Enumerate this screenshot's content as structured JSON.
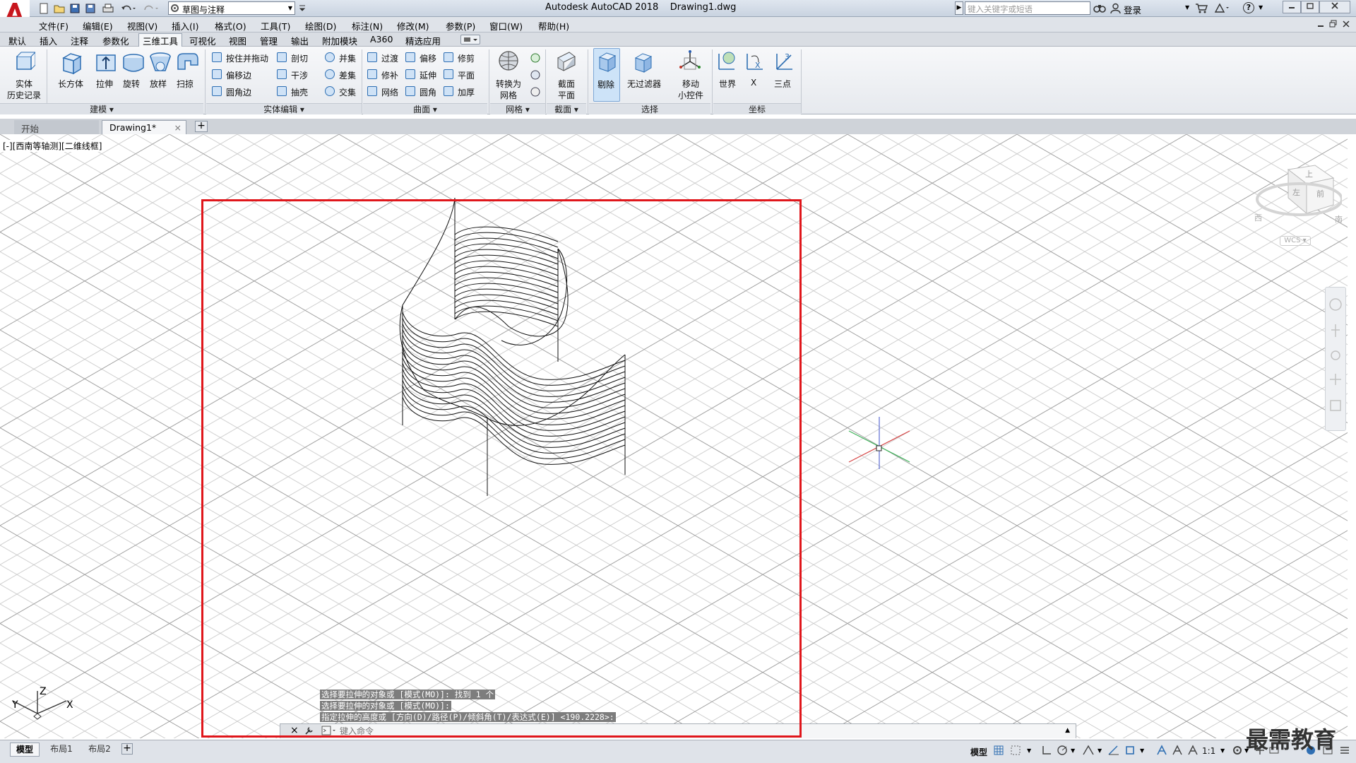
{
  "title": {
    "app_name": "Autodesk AutoCAD 2018",
    "file_name": "Drawing1.dwg"
  },
  "quick_access": {
    "workspace": "草图与注释"
  },
  "search": {
    "placeholder": "键入关键字或短语",
    "login_label": "登录"
  },
  "menu": [
    "文件(F)",
    "编辑(E)",
    "视图(V)",
    "插入(I)",
    "格式(O)",
    "工具(T)",
    "绘图(D)",
    "标注(N)",
    "修改(M)",
    "参数(P)",
    "窗口(W)",
    "帮助(H)"
  ],
  "ribbon_tabs": [
    "默认",
    "插入",
    "注释",
    "参数化",
    "三维工具",
    "可视化",
    "视图",
    "管理",
    "输出",
    "附加模块",
    "A360",
    "精选应用"
  ],
  "active_ribbon_tab": "三维工具",
  "ribbon": {
    "history_line1": "实体",
    "history_line2": "历史记录",
    "modeling_tools": [
      "长方体",
      "拉伸",
      "旋转",
      "放样",
      "扫掠"
    ],
    "solid_edit_col1": [
      "按住并拖动",
      "偏移边",
      "圆角边"
    ],
    "solid_edit_col2": [
      "剖切",
      "干涉",
      "抽壳"
    ],
    "solid_edit_col3": [
      "并集",
      "差集",
      "交集"
    ],
    "surface_col1": [
      "过渡",
      "修补",
      "网络"
    ],
    "surface_col2": [
      "偏移",
      "延伸",
      "圆角"
    ],
    "surface_col3": [
      "修剪",
      "平面",
      "加厚"
    ],
    "mesh_line1": "转换为",
    "mesh_line2": "网格",
    "section_line1": "截面",
    "section_line2": "平面",
    "select_tools": [
      "剔除",
      "无过滤器"
    ],
    "gizmo_line1": "移动",
    "gizmo_line2": "小控件",
    "coord_tools": [
      "世界",
      "X",
      "三点"
    ],
    "panels": [
      "建模",
      "实体编辑",
      "曲面",
      "网格",
      "截面",
      "选择",
      "坐标"
    ]
  },
  "file_tabs": [
    "开始",
    "Drawing1*"
  ],
  "viewport": {
    "label": "[-][西南等轴测][二维线框]"
  },
  "viewcube": {
    "top": "上",
    "front": "前",
    "left": "左",
    "south": "南",
    "west": "西",
    "wcs": "WCS"
  },
  "ucs": {
    "x": "X",
    "y": "Y",
    "z": "Z"
  },
  "command": {
    "history": [
      "选择要拉伸的对象或 [模式(MO)]: 找到 1 个",
      "选择要拉伸的对象或 [模式(MO)]:",
      "指定拉伸的高度或 [方向(D)/路径(P)/倾斜角(T)/表达式(E)] <190.2228>:"
    ],
    "placeholder": "键入命令"
  },
  "layout_tabs": [
    "模型",
    "布局1",
    "布局2"
  ],
  "status": {
    "mode": "模型",
    "scale": "1:1"
  },
  "watermark": "最需教育"
}
